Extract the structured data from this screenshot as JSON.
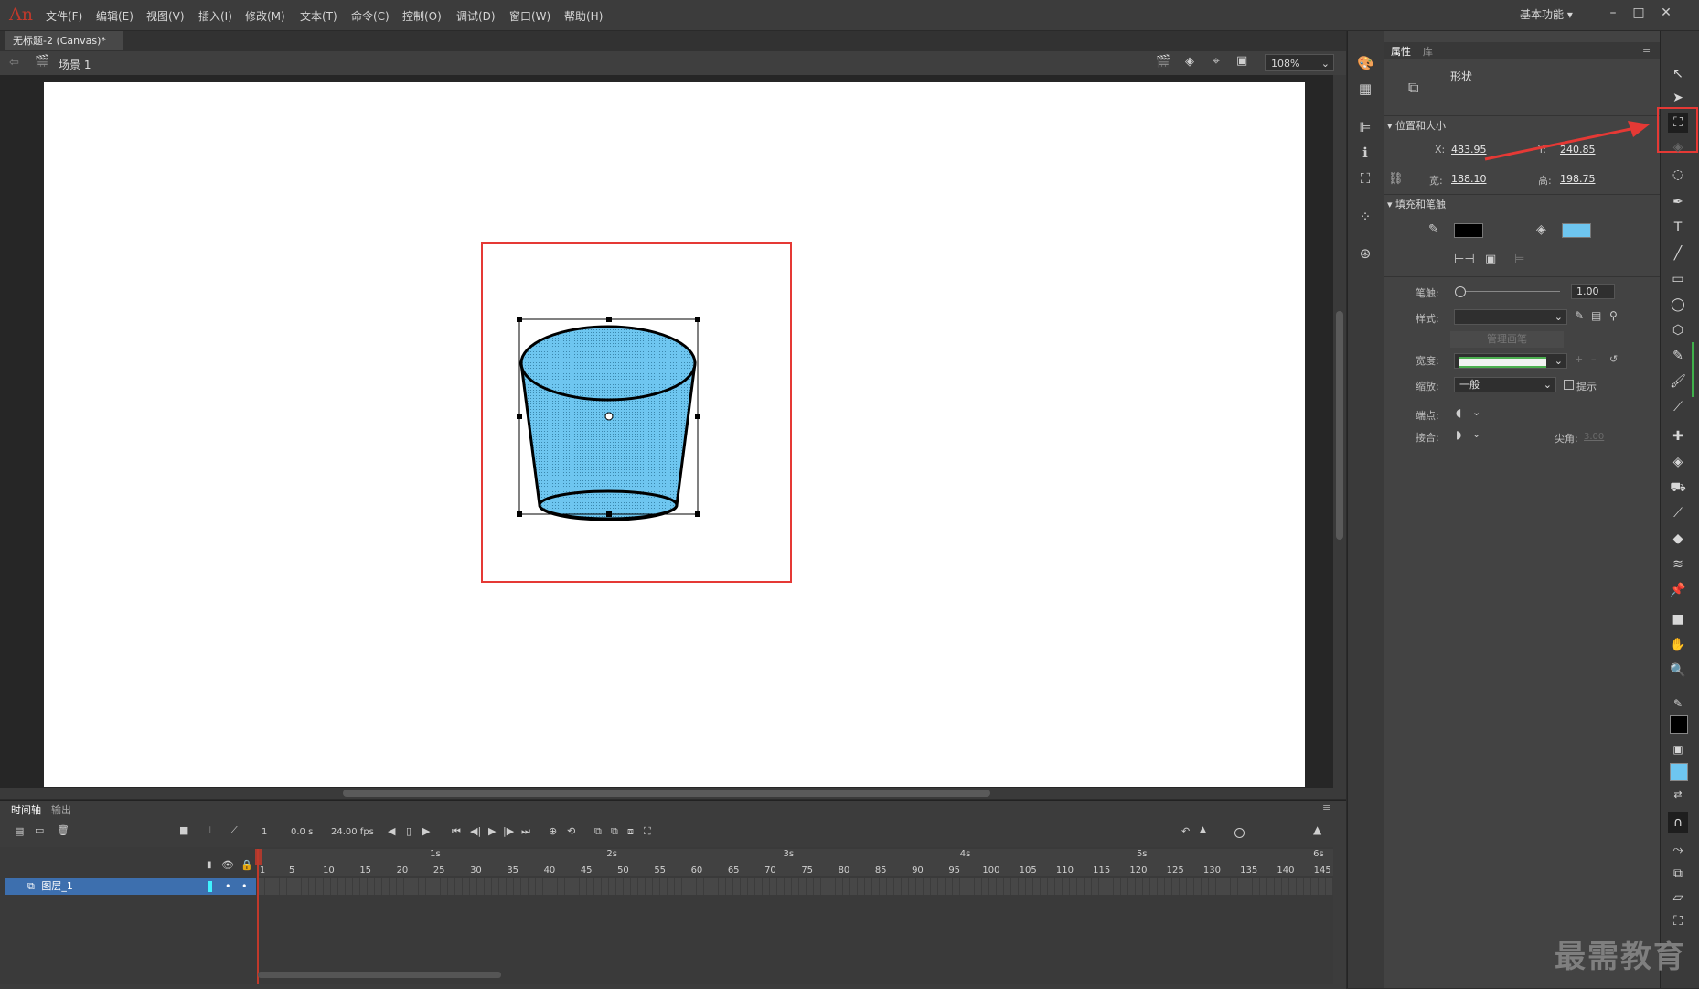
{
  "app": {
    "logo": "An",
    "menu": [
      "文件(F)",
      "编辑(E)",
      "视图(V)",
      "插入(I)",
      "修改(M)",
      "文本(T)",
      "命令(C)",
      "控制(O)",
      "调试(D)",
      "窗口(W)",
      "帮助(H)"
    ],
    "workspace": "基本功能",
    "window_buttons": [
      "–",
      "□",
      "✕"
    ]
  },
  "document": {
    "tab_title": "无标题-2 (Canvas)*",
    "tab_close": "×",
    "scene": "场景 1",
    "zoom": "108%"
  },
  "timeline": {
    "tabs": [
      "时间轴",
      "输出"
    ],
    "current_frame": "1",
    "time": "0.0 s",
    "fps": "24.00 fps",
    "seconds": [
      "1s",
      "2s",
      "3s",
      "4s",
      "5s",
      "6s"
    ],
    "frame_numbers": [
      "1",
      "5",
      "10",
      "15",
      "20",
      "25",
      "30",
      "35",
      "40",
      "45",
      "50",
      "55",
      "60",
      "65",
      "70",
      "75",
      "80",
      "85",
      "90",
      "95",
      "100",
      "105",
      "110",
      "115",
      "120",
      "125",
      "130",
      "135",
      "140",
      "145"
    ],
    "layer_name": "图层_1"
  },
  "properties": {
    "tabs": [
      "属性",
      "库"
    ],
    "object_type": "形状",
    "position_section": "位置和大小",
    "x_label": "X:",
    "x_value": "483.95",
    "y_label": "Y:",
    "y_value": "240.85",
    "w_label": "宽:",
    "w_value": "188.10",
    "h_label": "高:",
    "h_value": "198.75",
    "fill_section": "填充和笔触",
    "stroke_color": "#000000",
    "fill_color": "#6ec6f0",
    "stroke_label": "笔触:",
    "stroke_value": "1.00",
    "style_label": "样式:",
    "manage_brush": "管理画笔",
    "width_label": "宽度:",
    "scale_label": "缩放:",
    "scale_value": "一般",
    "hint_label": "提示",
    "cap_label": "端点:",
    "join_label": "接合:",
    "miter_label": "尖角:",
    "miter_value": "3.00"
  },
  "watermark": "最需教育"
}
